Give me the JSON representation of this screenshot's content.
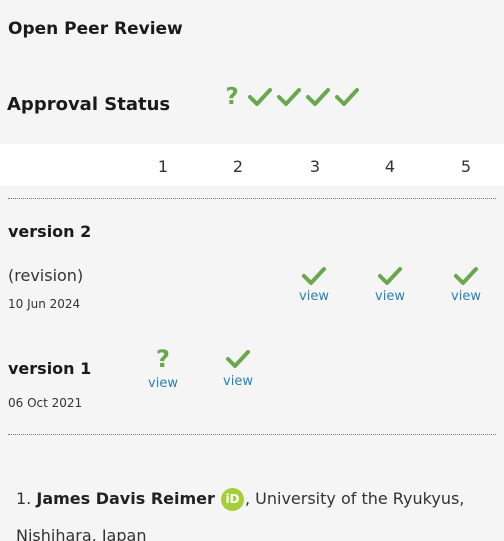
{
  "header": {
    "title": "Open Peer Review"
  },
  "approval": {
    "label": "Approval Status",
    "icons": [
      "question-icon",
      "check-icon",
      "check-icon",
      "check-icon",
      "check-icon"
    ]
  },
  "columns": [
    "1",
    "2",
    "3",
    "4",
    "5"
  ],
  "versions": [
    {
      "label": "version 2",
      "sublabel": "(revision)",
      "date": "10 Jun 2024",
      "reviews": [
        "",
        "",
        "approved",
        "approved",
        "approved"
      ]
    },
    {
      "label": "version 1",
      "date": "06 Oct 2021",
      "reviews": [
        "question",
        "approved",
        "",
        "",
        ""
      ]
    }
  ],
  "view_label": "view",
  "reviewer": {
    "index": "1.",
    "name": "James Davis Reimer",
    "orcid_badge": "iD",
    "affiliation": ", University of the Ryukyus, Nishihara, Japan"
  },
  "colors": {
    "approved_green": "#6aa84f",
    "link_blue": "#2980b9",
    "orcid_green": "#a6ce39"
  }
}
